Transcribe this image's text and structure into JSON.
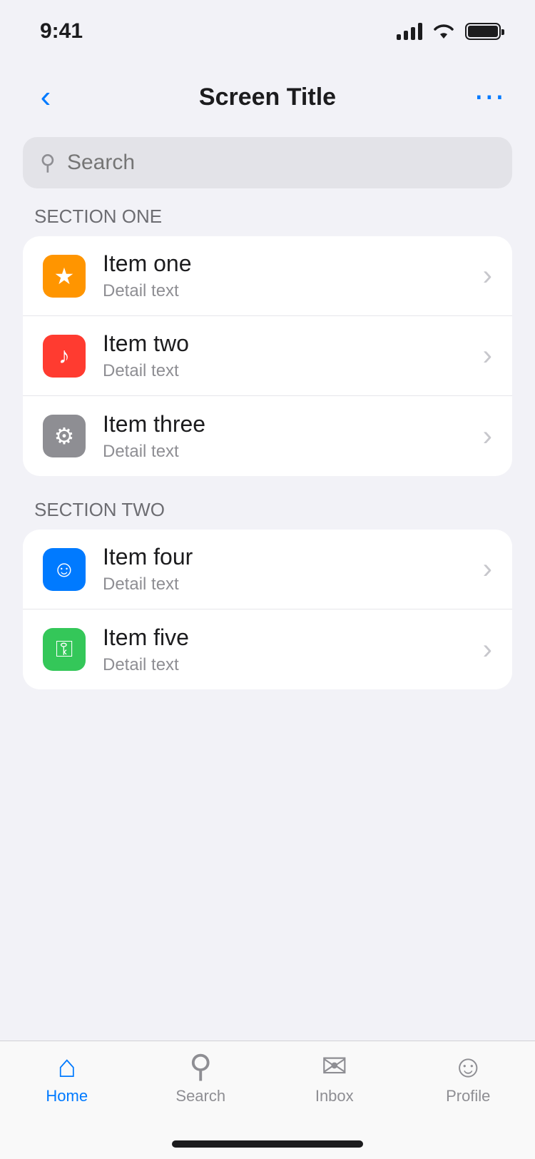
{
  "status_bar": {
    "time": "9:41"
  },
  "nav": {
    "title": "Screen Title",
    "back_icon": "chevron-left-icon",
    "action_icon": "ellipsis-icon"
  },
  "search": {
    "placeholder": "Search",
    "value": ""
  },
  "sections": [
    {
      "header": "Section One",
      "rows": [
        {
          "title": "Item one",
          "subtitle": "Detail text",
          "icon": "star-icon",
          "color": "#ff9500"
        },
        {
          "title": "Item two",
          "subtitle": "Detail text",
          "icon": "bell-icon",
          "color": "#ff3b30"
        },
        {
          "title": "Item three",
          "subtitle": "Detail text",
          "icon": "gear-icon",
          "color": "#8e8e93"
        }
      ]
    },
    {
      "header": "Section Two",
      "rows": [
        {
          "title": "Item four",
          "subtitle": "Detail text",
          "icon": "user-icon",
          "color": "#007aff"
        },
        {
          "title": "Item five",
          "subtitle": "Detail text",
          "icon": "lock-icon",
          "color": "#34c759"
        }
      ]
    }
  ],
  "tabs": [
    {
      "label": "Home",
      "icon": "home-icon",
      "active": true
    },
    {
      "label": "Search",
      "icon": "search-icon",
      "active": false
    },
    {
      "label": "Inbox",
      "icon": "inbox-icon",
      "active": false
    },
    {
      "label": "Profile",
      "icon": "user-icon",
      "active": false
    }
  ],
  "accent_color": "#007aff"
}
